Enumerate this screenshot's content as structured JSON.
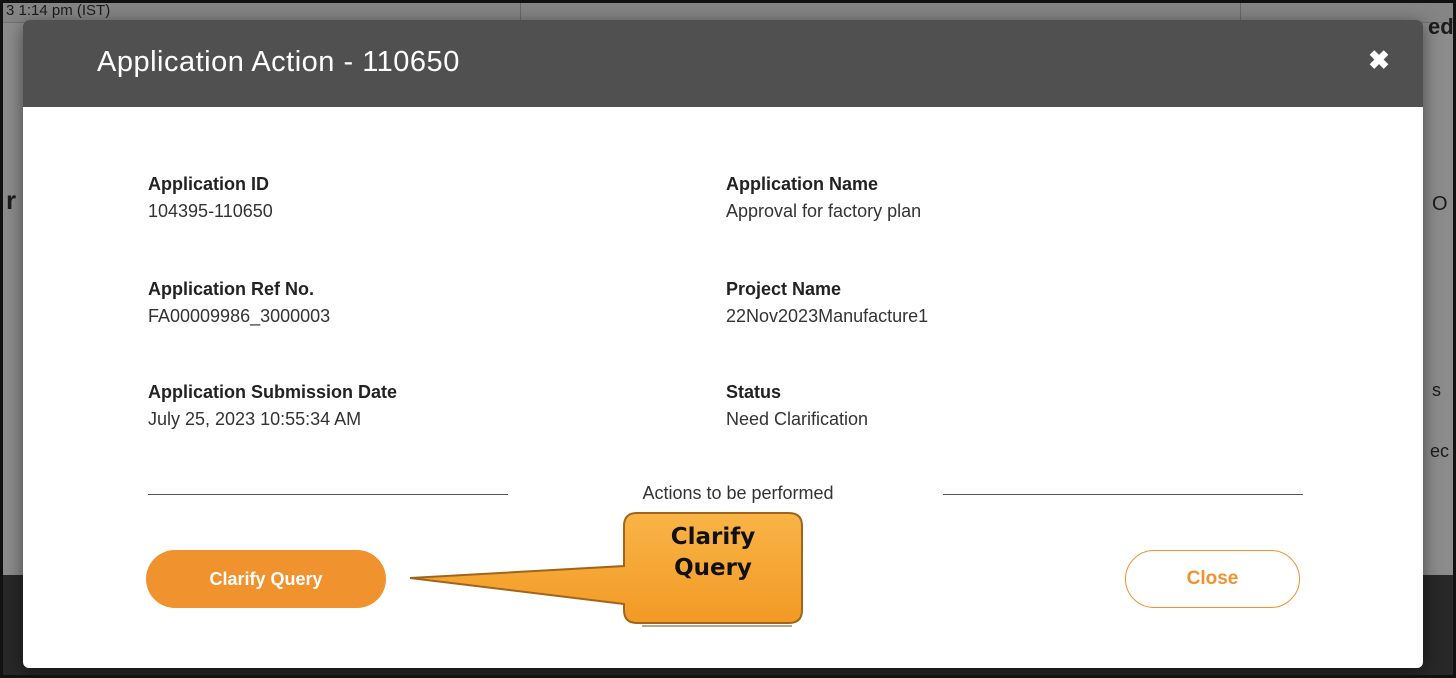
{
  "background": {
    "top_left_text": "3 1:14 pm (IST)",
    "right_partial_1": "ed",
    "right_partial_2": "O",
    "right_partial_3": "s",
    "right_partial_4": "ec",
    "left_partial_1": "r"
  },
  "modal": {
    "title": "Application Action - 110650",
    "close_icon": "close-icon",
    "fields": {
      "application_id": {
        "label": "Application ID",
        "value": "104395-110650"
      },
      "application_name": {
        "label": "Application Name",
        "value": "Approval for factory plan"
      },
      "application_ref": {
        "label": "Application Ref No.",
        "value": "FA00009986_3000003"
      },
      "project_name": {
        "label": "Project Name",
        "value": "22Nov2023Manufacture1"
      },
      "submission_date": {
        "label": "Application Submission Date",
        "value": "July 25, 2023 10:55:34 AM"
      },
      "status": {
        "label": "Status",
        "value": "Need Clarification"
      }
    },
    "actions_heading": "Actions to be performed",
    "clarify_button": "Clarify Query",
    "close_button": "Close"
  },
  "annotation": {
    "callout_line1": "Clarify",
    "callout_line2": "Query"
  },
  "colors": {
    "accent": "#f0922d",
    "header": "#505050",
    "callout_fill": "#f7a531"
  }
}
